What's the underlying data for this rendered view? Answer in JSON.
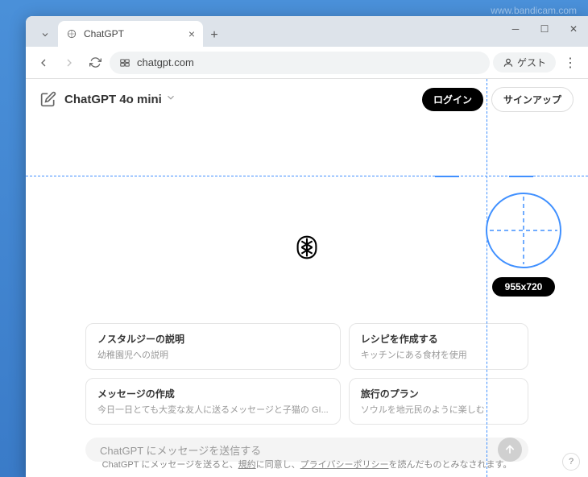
{
  "watermark": "www.bandicam.com",
  "browser": {
    "tab_title": "ChatGPT",
    "url": "chatgpt.com",
    "guest_label": "ゲスト"
  },
  "header": {
    "model": "ChatGPT 4o mini",
    "login": "ログイン",
    "signup": "サインアップ"
  },
  "overlay": {
    "size_label": "955x720"
  },
  "cards": [
    {
      "title": "ノスタルジーの説明",
      "sub": "幼稚園児への説明"
    },
    {
      "title": "レシピを作成する",
      "sub": "キッチンにある食材を使用"
    },
    {
      "title": "メッセージの作成",
      "sub": "今日一日とても大変な友人に送るメッセージと子猫の GI..."
    },
    {
      "title": "旅行のプラン",
      "sub": "ソウルを地元民のように楽しむ"
    }
  ],
  "input": {
    "placeholder": "ChatGPT にメッセージを送信する"
  },
  "footer": {
    "pre": "ChatGPT にメッセージを送ると、",
    "terms": "規約",
    "mid": "に同意し、",
    "privacy": "プライバシーポリシー",
    "post": "を読んだものとみなされます。"
  },
  "help": "?"
}
